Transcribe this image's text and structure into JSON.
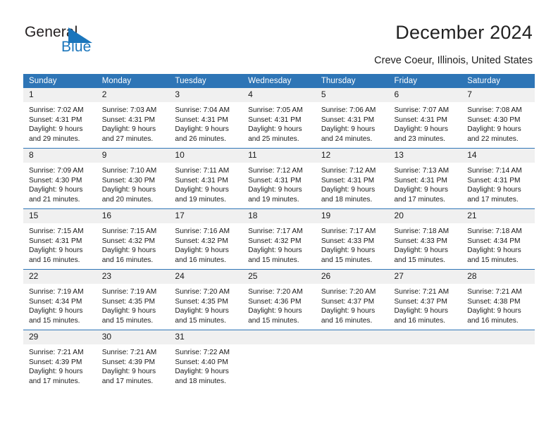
{
  "brand": {
    "name_part1": "General",
    "name_part2": "Blue",
    "accent_color": "#1b76bc"
  },
  "header": {
    "title": "December 2024",
    "subtitle": "Creve Coeur, Illinois, United States",
    "header_bg_color": "#2e75b6",
    "daynum_bg_color": "#f0f0f0"
  },
  "weekdays": [
    "Sunday",
    "Monday",
    "Tuesday",
    "Wednesday",
    "Thursday",
    "Friday",
    "Saturday"
  ],
  "weeks": [
    [
      {
        "day": "1",
        "sunrise": "Sunrise: 7:02 AM",
        "sunset": "Sunset: 4:31 PM",
        "daylight": "Daylight: 9 hours and 29 minutes."
      },
      {
        "day": "2",
        "sunrise": "Sunrise: 7:03 AM",
        "sunset": "Sunset: 4:31 PM",
        "daylight": "Daylight: 9 hours and 27 minutes."
      },
      {
        "day": "3",
        "sunrise": "Sunrise: 7:04 AM",
        "sunset": "Sunset: 4:31 PM",
        "daylight": "Daylight: 9 hours and 26 minutes."
      },
      {
        "day": "4",
        "sunrise": "Sunrise: 7:05 AM",
        "sunset": "Sunset: 4:31 PM",
        "daylight": "Daylight: 9 hours and 25 minutes."
      },
      {
        "day": "5",
        "sunrise": "Sunrise: 7:06 AM",
        "sunset": "Sunset: 4:31 PM",
        "daylight": "Daylight: 9 hours and 24 minutes."
      },
      {
        "day": "6",
        "sunrise": "Sunrise: 7:07 AM",
        "sunset": "Sunset: 4:31 PM",
        "daylight": "Daylight: 9 hours and 23 minutes."
      },
      {
        "day": "7",
        "sunrise": "Sunrise: 7:08 AM",
        "sunset": "Sunset: 4:30 PM",
        "daylight": "Daylight: 9 hours and 22 minutes."
      }
    ],
    [
      {
        "day": "8",
        "sunrise": "Sunrise: 7:09 AM",
        "sunset": "Sunset: 4:30 PM",
        "daylight": "Daylight: 9 hours and 21 minutes."
      },
      {
        "day": "9",
        "sunrise": "Sunrise: 7:10 AM",
        "sunset": "Sunset: 4:30 PM",
        "daylight": "Daylight: 9 hours and 20 minutes."
      },
      {
        "day": "10",
        "sunrise": "Sunrise: 7:11 AM",
        "sunset": "Sunset: 4:31 PM",
        "daylight": "Daylight: 9 hours and 19 minutes."
      },
      {
        "day": "11",
        "sunrise": "Sunrise: 7:12 AM",
        "sunset": "Sunset: 4:31 PM",
        "daylight": "Daylight: 9 hours and 19 minutes."
      },
      {
        "day": "12",
        "sunrise": "Sunrise: 7:12 AM",
        "sunset": "Sunset: 4:31 PM",
        "daylight": "Daylight: 9 hours and 18 minutes."
      },
      {
        "day": "13",
        "sunrise": "Sunrise: 7:13 AM",
        "sunset": "Sunset: 4:31 PM",
        "daylight": "Daylight: 9 hours and 17 minutes."
      },
      {
        "day": "14",
        "sunrise": "Sunrise: 7:14 AM",
        "sunset": "Sunset: 4:31 PM",
        "daylight": "Daylight: 9 hours and 17 minutes."
      }
    ],
    [
      {
        "day": "15",
        "sunrise": "Sunrise: 7:15 AM",
        "sunset": "Sunset: 4:31 PM",
        "daylight": "Daylight: 9 hours and 16 minutes."
      },
      {
        "day": "16",
        "sunrise": "Sunrise: 7:15 AM",
        "sunset": "Sunset: 4:32 PM",
        "daylight": "Daylight: 9 hours and 16 minutes."
      },
      {
        "day": "17",
        "sunrise": "Sunrise: 7:16 AM",
        "sunset": "Sunset: 4:32 PM",
        "daylight": "Daylight: 9 hours and 16 minutes."
      },
      {
        "day": "18",
        "sunrise": "Sunrise: 7:17 AM",
        "sunset": "Sunset: 4:32 PM",
        "daylight": "Daylight: 9 hours and 15 minutes."
      },
      {
        "day": "19",
        "sunrise": "Sunrise: 7:17 AM",
        "sunset": "Sunset: 4:33 PM",
        "daylight": "Daylight: 9 hours and 15 minutes."
      },
      {
        "day": "20",
        "sunrise": "Sunrise: 7:18 AM",
        "sunset": "Sunset: 4:33 PM",
        "daylight": "Daylight: 9 hours and 15 minutes."
      },
      {
        "day": "21",
        "sunrise": "Sunrise: 7:18 AM",
        "sunset": "Sunset: 4:34 PM",
        "daylight": "Daylight: 9 hours and 15 minutes."
      }
    ],
    [
      {
        "day": "22",
        "sunrise": "Sunrise: 7:19 AM",
        "sunset": "Sunset: 4:34 PM",
        "daylight": "Daylight: 9 hours and 15 minutes."
      },
      {
        "day": "23",
        "sunrise": "Sunrise: 7:19 AM",
        "sunset": "Sunset: 4:35 PM",
        "daylight": "Daylight: 9 hours and 15 minutes."
      },
      {
        "day": "24",
        "sunrise": "Sunrise: 7:20 AM",
        "sunset": "Sunset: 4:35 PM",
        "daylight": "Daylight: 9 hours and 15 minutes."
      },
      {
        "day": "25",
        "sunrise": "Sunrise: 7:20 AM",
        "sunset": "Sunset: 4:36 PM",
        "daylight": "Daylight: 9 hours and 15 minutes."
      },
      {
        "day": "26",
        "sunrise": "Sunrise: 7:20 AM",
        "sunset": "Sunset: 4:37 PM",
        "daylight": "Daylight: 9 hours and 16 minutes."
      },
      {
        "day": "27",
        "sunrise": "Sunrise: 7:21 AM",
        "sunset": "Sunset: 4:37 PM",
        "daylight": "Daylight: 9 hours and 16 minutes."
      },
      {
        "day": "28",
        "sunrise": "Sunrise: 7:21 AM",
        "sunset": "Sunset: 4:38 PM",
        "daylight": "Daylight: 9 hours and 16 minutes."
      }
    ],
    [
      {
        "day": "29",
        "sunrise": "Sunrise: 7:21 AM",
        "sunset": "Sunset: 4:39 PM",
        "daylight": "Daylight: 9 hours and 17 minutes."
      },
      {
        "day": "30",
        "sunrise": "Sunrise: 7:21 AM",
        "sunset": "Sunset: 4:39 PM",
        "daylight": "Daylight: 9 hours and 17 minutes."
      },
      {
        "day": "31",
        "sunrise": "Sunrise: 7:22 AM",
        "sunset": "Sunset: 4:40 PM",
        "daylight": "Daylight: 9 hours and 18 minutes."
      },
      {
        "day": "",
        "sunrise": "",
        "sunset": "",
        "daylight": ""
      },
      {
        "day": "",
        "sunrise": "",
        "sunset": "",
        "daylight": ""
      },
      {
        "day": "",
        "sunrise": "",
        "sunset": "",
        "daylight": ""
      },
      {
        "day": "",
        "sunrise": "",
        "sunset": "",
        "daylight": ""
      }
    ]
  ]
}
